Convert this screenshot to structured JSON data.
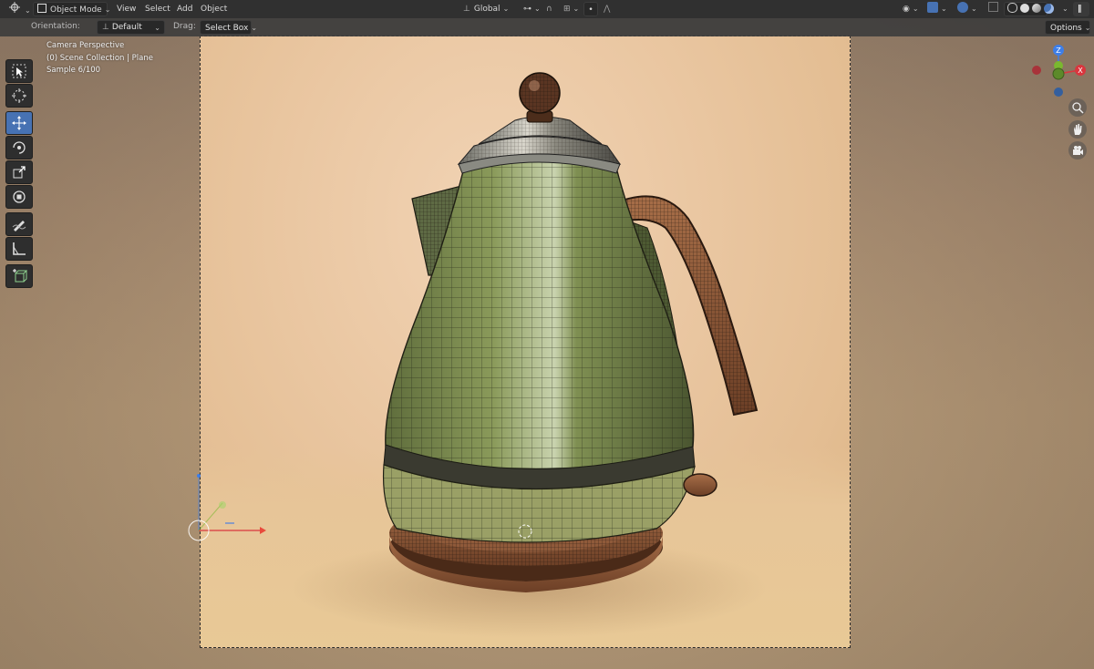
{
  "header": {
    "editor_type_icon": "editor-type-icon",
    "mode": "Object Mode",
    "menus": [
      "View",
      "Select",
      "Add",
      "Object"
    ],
    "transform_orientation": "Global",
    "pivot_icon": "pivot-icon",
    "snap_icon": "magnet-icon",
    "proportional_icon": "proportional-icon"
  },
  "tool_settings": {
    "orientation_label": "Orientation:",
    "orientation_value": "Default",
    "drag_label": "Drag:",
    "drag_value": "Select Box",
    "options_label": "Options"
  },
  "viewport": {
    "view_name": "Camera Perspective",
    "collection_info": "(0) Scene Collection | Plane",
    "sample_info": "Sample 6/100"
  },
  "gizmo": {
    "z_label": "Z",
    "x_color": "#d9363e",
    "y_color": "#7ab82f",
    "z_color": "#3d7ee8"
  },
  "toolbar": {
    "tools": [
      "select-box",
      "cursor",
      "move",
      "rotate",
      "scale",
      "transform",
      "annotate",
      "measure",
      "add-cube"
    ],
    "active": "move"
  },
  "colors": {
    "accent": "#4772b3",
    "header_bg": "#303030",
    "kettle_body": "#7a8a4e",
    "kettle_wood": "#8e5a3c"
  }
}
